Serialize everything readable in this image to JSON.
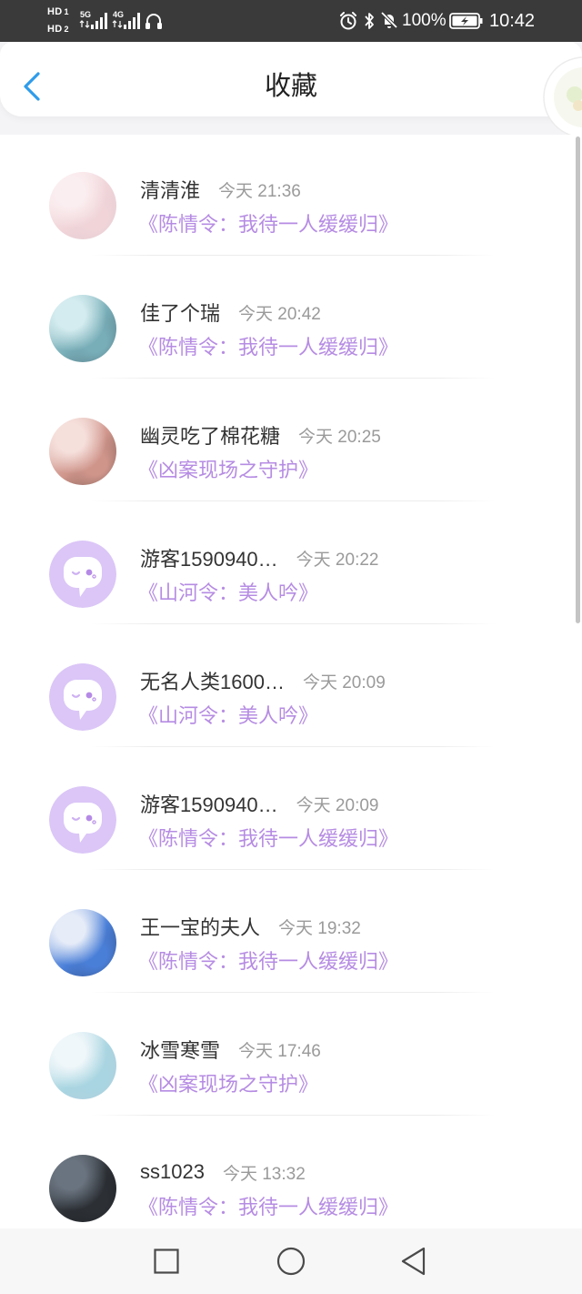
{
  "status_bar": {
    "hd_label": "HD",
    "sim_1": "1",
    "sim_2": "2",
    "network_1": "5G",
    "network_2": "4G",
    "battery_percent": "100%",
    "time": "10:42",
    "icons": [
      "signal-bars-icon",
      "headphones-icon",
      "alarm-icon",
      "bluetooth-icon",
      "bell-muted-icon",
      "battery-charging-icon"
    ]
  },
  "header": {
    "title": "收藏",
    "back_icon": "chevron-left-icon"
  },
  "favorites": [
    {
      "name": "清清淮",
      "time": "今天 21:36",
      "book": "《陈情令：我待一人缓缓归》",
      "avatar_colors": [
        "#fbeef0",
        "#f0d4d8",
        "#d6c6d2"
      ]
    },
    {
      "name": "佳了个瑞",
      "time": "今天 20:42",
      "book": "《陈情令：我待一人缓缓归》",
      "avatar_colors": [
        "#d4ecef",
        "#78aeb8",
        "#3b4b57"
      ]
    },
    {
      "name": "幽灵吃了棉花糖",
      "time": "今天 20:25",
      "book": "《凶案现场之守护》",
      "avatar_colors": [
        "#f6e0dc",
        "#cf958b",
        "#3a2a24"
      ]
    },
    {
      "name": "游客1590940…",
      "time": "今天 20:22",
      "book": "《山河令：美人吟》",
      "avatar_icon": "default-avatar-icon"
    },
    {
      "name": "无名人类1600…",
      "time": "今天 20:09",
      "book": "《山河令：美人吟》",
      "avatar_icon": "default-avatar-icon"
    },
    {
      "name": "游客1590940…",
      "time": "今天 20:09",
      "book": "《陈情令：我待一人缓缓归》",
      "avatar_icon": "default-avatar-icon"
    },
    {
      "name": "王一宝的夫人",
      "time": "今天 19:32",
      "book": "《陈情令：我待一人缓缓归》",
      "avatar_colors": [
        "#e6ecf8",
        "#4a7fd8",
        "#252a42"
      ]
    },
    {
      "name": "冰雪寒雪",
      "time": "今天 17:46",
      "book": "《凶案现场之守护》",
      "avatar_colors": [
        "#f0f7fa",
        "#a8d5e1",
        "#c5c6dc"
      ]
    },
    {
      "name": "ss1023",
      "time": "今天 13:32",
      "book": "《陈情令：我待一人缓缓归》",
      "avatar_colors": [
        "#6a7480",
        "#2c3035",
        "#14171b"
      ]
    }
  ],
  "nav_bar": {
    "icons": [
      "recent-apps-icon",
      "home-icon",
      "back-icon"
    ]
  },
  "colors": {
    "status_bar_bg": "#3a3a3a",
    "accent_blue": "#2f9cea",
    "book_title": "#b68ce3",
    "name_text": "#333333",
    "time_text": "#9a9a9a",
    "default_avatar_bg": "#dbc6f7"
  }
}
